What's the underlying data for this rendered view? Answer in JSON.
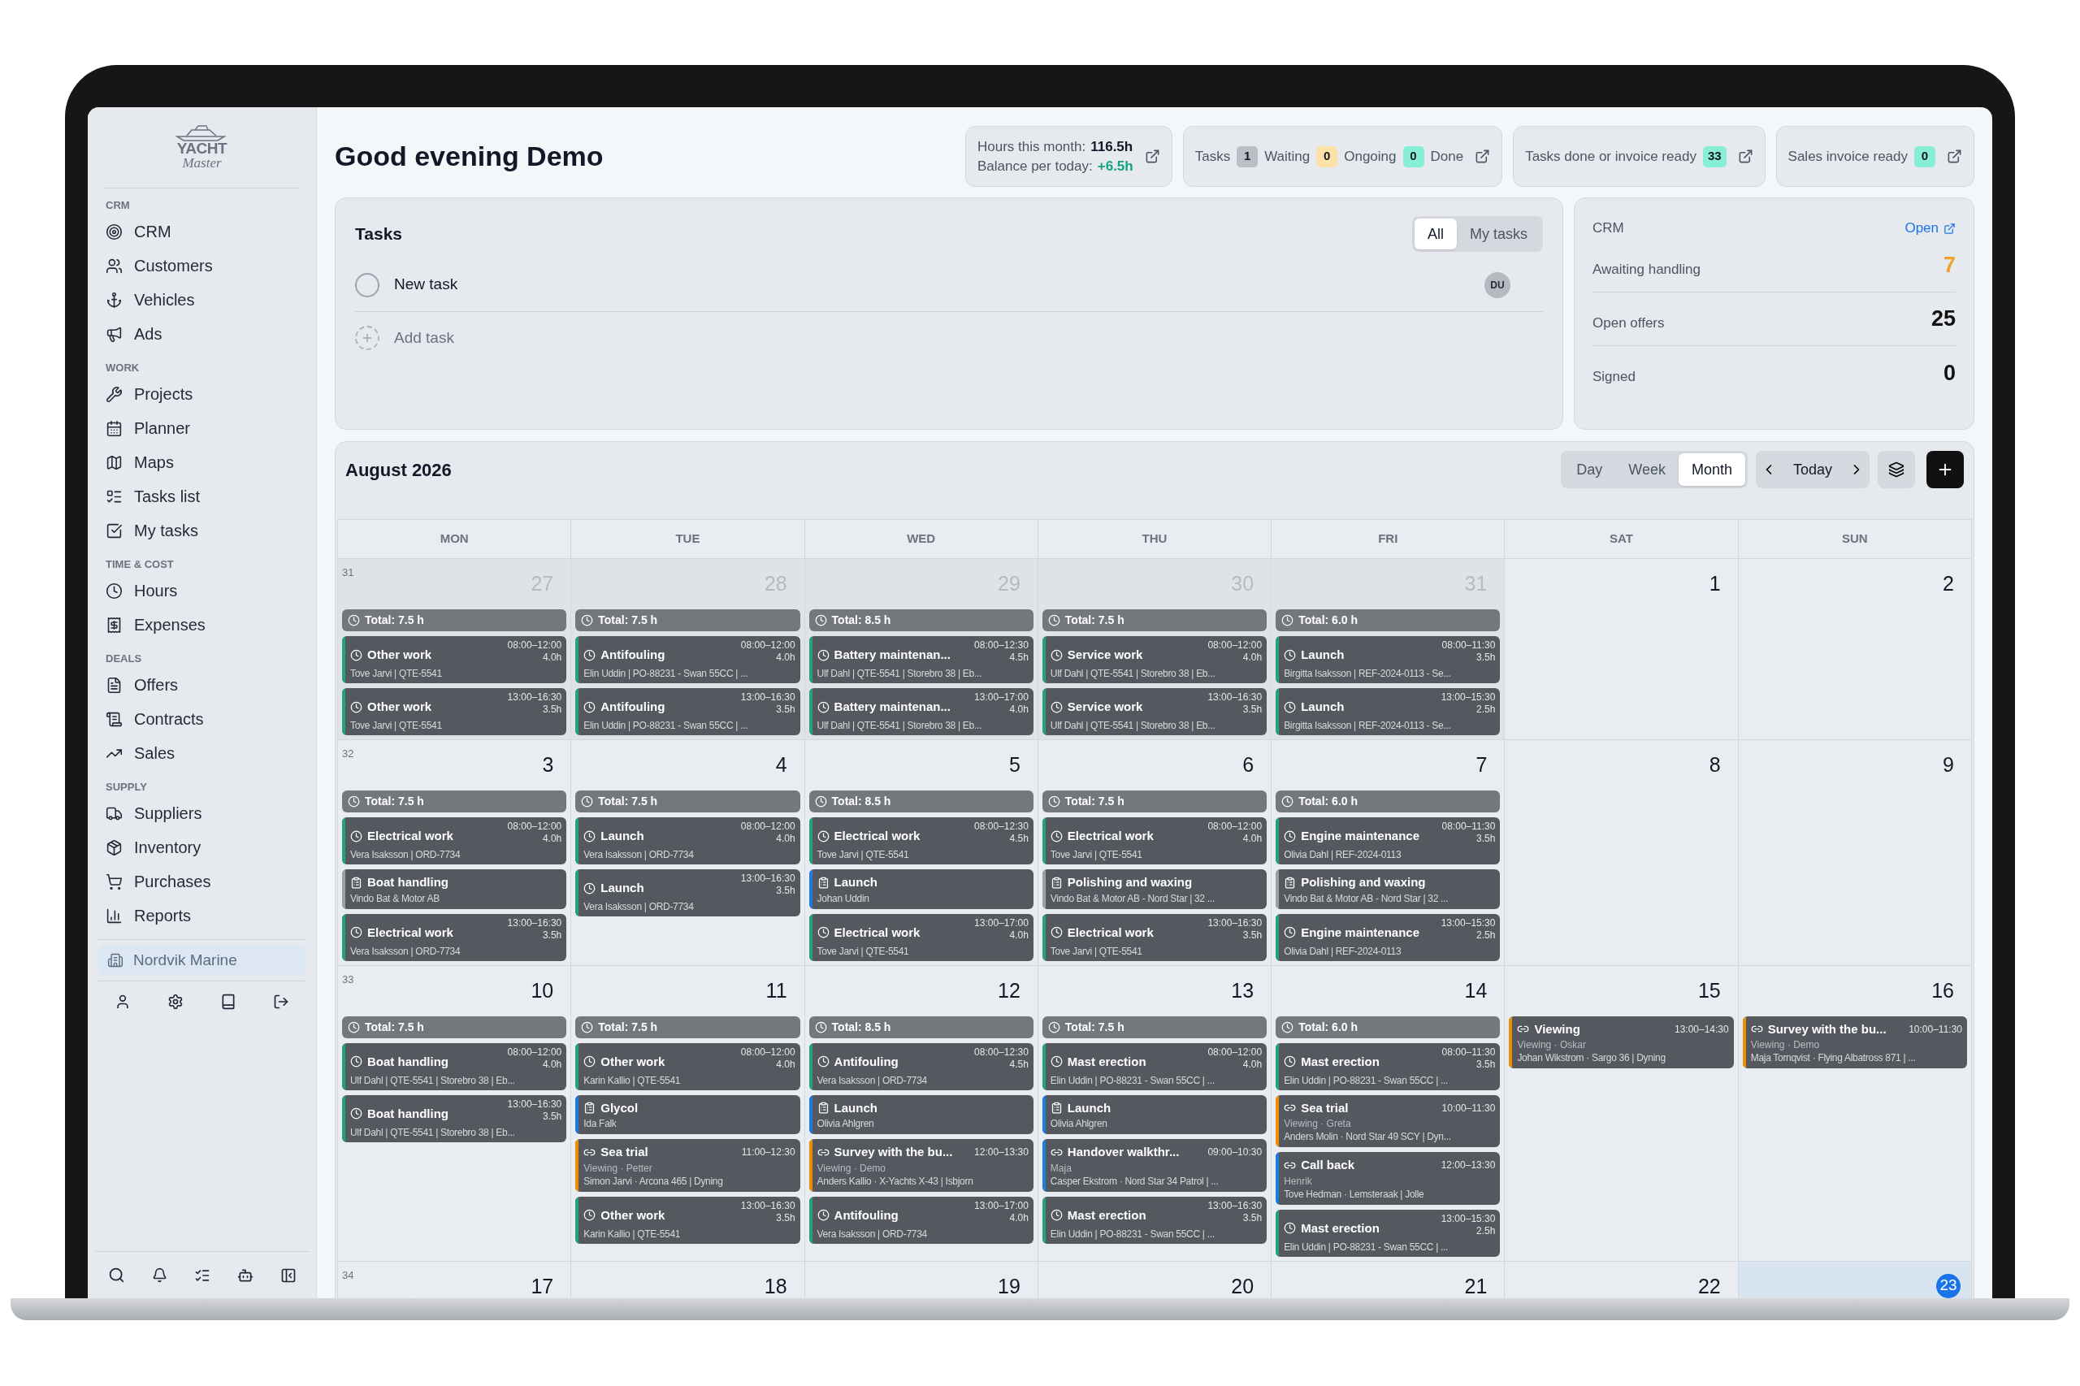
{
  "sidebar": {
    "logo": {
      "title": "YACHT",
      "subtitle": "Master"
    },
    "sections": [
      {
        "label": "CRM",
        "items": [
          "CRM",
          "Customers",
          "Vehicles",
          "Ads"
        ]
      },
      {
        "label": "WORK",
        "items": [
          "Projects",
          "Planner",
          "Maps",
          "Tasks list",
          "My tasks"
        ]
      },
      {
        "label": "TIME & COST",
        "items": [
          "Hours",
          "Expenses"
        ]
      },
      {
        "label": "DEALS",
        "items": [
          "Offers",
          "Contracts",
          "Sales"
        ]
      },
      {
        "label": "SUPPLY",
        "items": [
          "Suppliers",
          "Inventory",
          "Purchases",
          "Reports"
        ]
      }
    ],
    "company": {
      "label": "Nordvik Marine",
      "selected": true
    }
  },
  "header": {
    "greeting": "Good evening Demo",
    "hours": {
      "label": "Hours this month:",
      "value": "116.5h",
      "balance_label": "Balance per today:",
      "balance_value": "+6.5h"
    },
    "chips": [
      {
        "counters": [
          {
            "label": "Tasks",
            "count": "1",
            "color": "#babfc6"
          },
          {
            "label": "Waiting",
            "count": "0",
            "color": "#fde1a6"
          },
          {
            "label": "Ongoing",
            "count": "0",
            "color": "#86efd6"
          },
          {
            "label": "Done"
          }
        ]
      },
      {
        "counters": [
          {
            "label": "Tasks done or invoice ready",
            "count": "33",
            "color": "#86efd6"
          }
        ]
      },
      {
        "counters": [
          {
            "label": "Sales invoice ready",
            "count": "0",
            "color": "#86efd6"
          }
        ]
      }
    ]
  },
  "tasks": {
    "title": "Tasks",
    "filters": [
      {
        "label": "All",
        "selected": true
      },
      {
        "label": "My tasks",
        "selected": false
      }
    ],
    "items": [
      {
        "title": "New task",
        "checked": false,
        "assignee": "DU"
      }
    ],
    "add_placeholder": "Add task"
  },
  "crm": {
    "title": "CRM",
    "link": "Open",
    "rows": [
      {
        "label": "Awaiting handling",
        "value": "7",
        "color": "#f0a22e"
      },
      {
        "label": "Open offers",
        "value": "25",
        "color": "#111111"
      },
      {
        "label": "Signed",
        "value": "0",
        "color": "#111111"
      }
    ]
  },
  "calendar": {
    "title": "August 2026",
    "views": [
      {
        "label": "Day",
        "selected": false
      },
      {
        "label": "Week",
        "selected": false
      },
      {
        "label": "Month",
        "selected": true
      }
    ],
    "today_button": "Today",
    "weekdays": [
      "MON",
      "TUE",
      "WED",
      "THU",
      "FRI",
      "SAT",
      "SUN"
    ],
    "weeks": [
      {
        "number": "31",
        "days": [
          {
            "date": "27",
            "outside": true,
            "today": false,
            "total": "Total: 7.5 h",
            "events": [
              {
                "kind": "work",
                "title": "Other work",
                "time": "08:00–12:00",
                "hours": "4.0h",
                "detail": "Tove Jarvi | QTE-5541",
                "color": "#22a37f"
              },
              {
                "kind": "work",
                "title": "Other work",
                "time": "13:00–16:30",
                "hours": "3.5h",
                "detail": "Tove Jarvi | QTE-5541",
                "color": "#22a37f"
              }
            ]
          },
          {
            "date": "28",
            "outside": true,
            "today": false,
            "total": "Total: 7.5 h",
            "events": [
              {
                "kind": "work",
                "title": "Antifouling",
                "time": "08:00–12:00",
                "hours": "4.0h",
                "detail": "Elin Uddin | PO-88231 - Swan 55CC | ...",
                "color": "#22a37f"
              },
              {
                "kind": "work",
                "title": "Antifouling",
                "time": "13:00–16:30",
                "hours": "3.5h",
                "detail": "Elin Uddin | PO-88231 - Swan 55CC | ...",
                "color": "#22a37f"
              }
            ]
          },
          {
            "date": "29",
            "outside": true,
            "today": false,
            "total": "Total: 8.5 h",
            "events": [
              {
                "kind": "work",
                "title": "Battery maintenan...",
                "time": "08:00–12:30",
                "hours": "4.5h",
                "detail": "Ulf Dahl | QTE-5541 | Storebro 38 | Eb...",
                "color": "#22a37f"
              },
              {
                "kind": "work",
                "title": "Battery maintenan...",
                "time": "13:00–17:00",
                "hours": "4.0h",
                "detail": "Ulf Dahl | QTE-5541 | Storebro 38 | Eb...",
                "color": "#22a37f"
              }
            ]
          },
          {
            "date": "30",
            "outside": true,
            "today": false,
            "total": "Total: 7.5 h",
            "events": [
              {
                "kind": "work",
                "title": "Service work",
                "time": "08:00–12:00",
                "hours": "4.0h",
                "detail": "Ulf Dahl | QTE-5541 | Storebro 38 | Eb...",
                "color": "#22a37f"
              },
              {
                "kind": "work",
                "title": "Service work",
                "time": "13:00–16:30",
                "hours": "3.5h",
                "detail": "Ulf Dahl | QTE-5541 | Storebro 38 | Eb...",
                "color": "#22a37f"
              }
            ]
          },
          {
            "date": "31",
            "outside": true,
            "today": false,
            "total": "Total: 6.0 h",
            "events": [
              {
                "kind": "work",
                "title": "Launch",
                "time": "08:00–11:30",
                "hours": "3.5h",
                "detail": "Birgitta Isaksson | REF-2024-0113 - Se...",
                "color": "#22a37f"
              },
              {
                "kind": "work",
                "title": "Launch",
                "time": "13:00–15:30",
                "hours": "2.5h",
                "detail": "Birgitta Isaksson | REF-2024-0113 - Se...",
                "color": "#22a37f"
              }
            ]
          },
          {
            "date": "1",
            "outside": false,
            "today": false
          },
          {
            "date": "2",
            "outside": false,
            "today": false
          }
        ]
      },
      {
        "number": "32",
        "days": [
          {
            "date": "3",
            "outside": false,
            "today": false,
            "total": "Total: 7.5 h",
            "events": [
              {
                "kind": "work",
                "title": "Electrical work",
                "time": "08:00–12:00",
                "hours": "4.0h",
                "detail": "Vera Isaksson | ORD-7734",
                "color": "#22a37f"
              },
              {
                "kind": "task",
                "title": "Boat handling",
                "detail": "Vindo Bat & Motor AB",
                "color": "#9aa0a6"
              },
              {
                "kind": "work",
                "title": "Electrical work",
                "time": "13:00–16:30",
                "hours": "3.5h",
                "detail": "Vera Isaksson | ORD-7734",
                "color": "#22a37f"
              }
            ]
          },
          {
            "date": "4",
            "outside": false,
            "today": false,
            "total": "Total: 7.5 h",
            "events": [
              {
                "kind": "work",
                "title": "Launch",
                "time": "08:00–12:00",
                "hours": "4.0h",
                "detail": "Vera Isaksson | ORD-7734",
                "color": "#22a37f"
              },
              {
                "kind": "work",
                "title": "Launch",
                "time": "13:00–16:30",
                "hours": "3.5h",
                "detail": "Vera Isaksson | ORD-7734",
                "color": "#22a37f"
              }
            ]
          },
          {
            "date": "5",
            "outside": false,
            "today": false,
            "total": "Total: 8.5 h",
            "events": [
              {
                "kind": "work",
                "title": "Electrical work",
                "time": "08:00–12:30",
                "hours": "4.5h",
                "detail": "Tove Jarvi | QTE-5541",
                "color": "#22a37f"
              },
              {
                "kind": "task",
                "title": "Launch",
                "detail": "Johan Uddin",
                "color": "#1e7be0"
              },
              {
                "kind": "work",
                "title": "Electrical work",
                "time": "13:00–17:00",
                "hours": "4.0h",
                "detail": "Tove Jarvi | QTE-5541",
                "color": "#22a37f"
              }
            ]
          },
          {
            "date": "6",
            "outside": false,
            "today": false,
            "total": "Total: 7.5 h",
            "events": [
              {
                "kind": "work",
                "title": "Electrical work",
                "time": "08:00–12:00",
                "hours": "4.0h",
                "detail": "Tove Jarvi | QTE-5541",
                "color": "#22a37f"
              },
              {
                "kind": "task",
                "title": "Polishing and waxing",
                "detail": "Vindo Bat & Motor AB - Nord Star | 32 ...",
                "color": "#9aa0a6"
              },
              {
                "kind": "work",
                "title": "Electrical work",
                "time": "13:00–16:30",
                "hours": "3.5h",
                "detail": "Tove Jarvi | QTE-5541",
                "color": "#22a37f"
              }
            ]
          },
          {
            "date": "7",
            "outside": false,
            "today": false,
            "total": "Total: 6.0 h",
            "events": [
              {
                "kind": "work",
                "title": "Engine maintenance",
                "time": "08:00–11:30",
                "hours": "3.5h",
                "detail": "Olivia Dahl | REF-2024-0113",
                "color": "#22a37f"
              },
              {
                "kind": "task",
                "title": "Polishing and waxing",
                "detail": "Vindo Bat & Motor AB - Nord Star | 32 ...",
                "color": "#9aa0a6"
              },
              {
                "kind": "work",
                "title": "Engine maintenance",
                "time": "13:00–15:30",
                "hours": "2.5h",
                "detail": "Olivia Dahl | REF-2024-0113",
                "color": "#22a37f"
              }
            ]
          },
          {
            "date": "8",
            "outside": false,
            "today": false
          },
          {
            "date": "9",
            "outside": false,
            "today": false
          }
        ]
      },
      {
        "number": "33",
        "days": [
          {
            "date": "10",
            "outside": false,
            "today": false,
            "total": "Total: 7.5 h",
            "events": [
              {
                "kind": "work",
                "title": "Boat handling",
                "time": "08:00–12:00",
                "hours": "4.0h",
                "detail": "Ulf Dahl | QTE-5541 | Storebro 38 | Eb...",
                "color": "#22a37f"
              },
              {
                "kind": "work",
                "title": "Boat handling",
                "time": "13:00–16:30",
                "hours": "3.5h",
                "detail": "Ulf Dahl | QTE-5541 | Storebro 38 | Eb...",
                "color": "#22a37f"
              }
            ]
          },
          {
            "date": "11",
            "outside": false,
            "today": false,
            "total": "Total: 7.5 h",
            "events": [
              {
                "kind": "work",
                "title": "Other work",
                "time": "08:00–12:00",
                "hours": "4.0h",
                "detail": "Karin Kallio | QTE-5541",
                "color": "#22a37f"
              },
              {
                "kind": "task",
                "title": "Glycol",
                "detail": "Ida Falk",
                "color": "#1e7be0"
              },
              {
                "kind": "viewing",
                "title": "Sea trial",
                "time": "11:00–12:30",
                "note": "Viewing · Petter",
                "detail": "Simon Jarvi · Arcona 465 | Dyning",
                "color": "#f08c00"
              },
              {
                "kind": "work",
                "title": "Other work",
                "time": "13:00–16:30",
                "hours": "3.5h",
                "detail": "Karin Kallio | QTE-5541",
                "color": "#22a37f"
              }
            ]
          },
          {
            "date": "12",
            "outside": false,
            "today": false,
            "total": "Total: 8.5 h",
            "events": [
              {
                "kind": "work",
                "title": "Antifouling",
                "time": "08:00–12:30",
                "hours": "4.5h",
                "detail": "Vera Isaksson | ORD-7734",
                "color": "#22a37f"
              },
              {
                "kind": "task",
                "title": "Launch",
                "detail": "Olivia Ahlgren",
                "color": "#1e7be0"
              },
              {
                "kind": "viewing",
                "title": "Survey with the bu...",
                "time": "12:00–13:30",
                "note": "Viewing · Demo",
                "detail": "Anders Kallio · X-Yachts X-43 | Isbjorn",
                "color": "#f08c00"
              },
              {
                "kind": "work",
                "title": "Antifouling",
                "time": "13:00–17:00",
                "hours": "4.0h",
                "detail": "Vera Isaksson | ORD-7734",
                "color": "#22a37f"
              }
            ]
          },
          {
            "date": "13",
            "outside": false,
            "today": false,
            "total": "Total: 7.5 h",
            "events": [
              {
                "kind": "work",
                "title": "Mast erection",
                "time": "08:00–12:00",
                "hours": "4.0h",
                "detail": "Elin Uddin | PO-88231 - Swan 55CC | ...",
                "color": "#22a37f"
              },
              {
                "kind": "task",
                "title": "Launch",
                "detail": "Olivia Ahlgren",
                "color": "#1e7be0"
              },
              {
                "kind": "viewing",
                "title": "Handover walkthr...",
                "time": "09:00–10:30",
                "note": "Maja",
                "detail": "Casper Ekstrom · Nord Star 34 Patrol | ...",
                "color": "#1e7be0"
              },
              {
                "kind": "work",
                "title": "Mast erection",
                "time": "13:00–16:30",
                "hours": "3.5h",
                "detail": "Elin Uddin | PO-88231 - Swan 55CC | ...",
                "color": "#22a37f"
              }
            ]
          },
          {
            "date": "14",
            "outside": false,
            "today": false,
            "total": "Total: 6.0 h",
            "events": [
              {
                "kind": "work",
                "title": "Mast erection",
                "time": "08:00–11:30",
                "hours": "3.5h",
                "detail": "Elin Uddin | PO-88231 - Swan 55CC | ...",
                "color": "#22a37f"
              },
              {
                "kind": "viewing",
                "title": "Sea trial",
                "time": "10:00–11:30",
                "note": "Viewing · Greta",
                "detail": "Anders Molin · Nord Star 49 SCY | Dyn...",
                "color": "#f08c00"
              },
              {
                "kind": "viewing",
                "title": "Call back",
                "time": "12:00–13:30",
                "note": "Henrik",
                "detail": "Tove Hedman · Lemsteraak | Jolle",
                "color": "#1e7be0"
              },
              {
                "kind": "work",
                "title": "Mast erection",
                "time": "13:00–15:30",
                "hours": "2.5h",
                "detail": "Elin Uddin | PO-88231 - Swan 55CC | ...",
                "color": "#22a37f"
              }
            ]
          },
          {
            "date": "15",
            "outside": false,
            "today": false,
            "events": [
              {
                "kind": "viewing",
                "title": "Viewing",
                "time": "13:00–14:30",
                "note": "Viewing · Oskar",
                "detail": "Johan Wikstrom · Sargo 36 | Dyning",
                "color": "#f08c00"
              }
            ]
          },
          {
            "date": "16",
            "outside": false,
            "today": false,
            "events": [
              {
                "kind": "viewing",
                "title": "Survey with the bu...",
                "time": "10:00–11:30",
                "note": "Viewing · Demo",
                "detail": "Maja Tornqvist · Flying Albatross 871 | ...",
                "color": "#f08c00"
              }
            ]
          }
        ]
      },
      {
        "number": "34",
        "days": [
          {
            "date": "17",
            "today": false
          },
          {
            "date": "18",
            "today": false
          },
          {
            "date": "19",
            "today": false
          },
          {
            "date": "20",
            "today": false
          },
          {
            "date": "21",
            "today": false
          },
          {
            "date": "22",
            "today": false
          },
          {
            "date": "23",
            "today": true
          }
        ]
      }
    ]
  }
}
